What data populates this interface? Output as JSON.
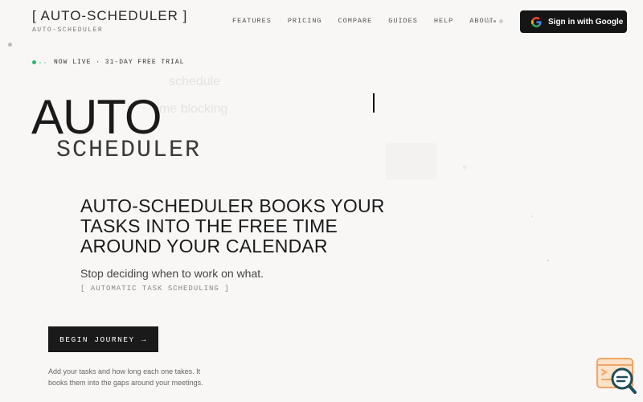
{
  "header": {
    "brand": "[ AUTO-SCHEDULER ]",
    "brand_sub": "AUTO-SCHEDULER",
    "nav": [
      "FEATURES",
      "PRICING",
      "COMPARE",
      "GUIDES",
      "HELP",
      "ABOUT"
    ],
    "signin_label": "Sign in with Google"
  },
  "hero": {
    "status": "NOW LIVE · 31-DAY FREE TRIAL",
    "ghost_words": [
      "schedule",
      "time blocking"
    ],
    "title_big": "AUTO",
    "title_small": "SCHEDULER",
    "headline": "AUTO-SCHEDULER BOOKS YOUR TASKS INTO THE FREE TIME AROUND YOUR CALENDAR",
    "subheadline": "Stop deciding when to work on what.",
    "tagline": "[ AUTOMATIC TASK SCHEDULING ]",
    "cta_label": "BEGIN JOURNEY",
    "cta_arrow": "→",
    "description": "Add your tasks and how long each one takes. It books them into the gaps around your meetings."
  },
  "colors": {
    "background": "#f8f7f5",
    "button_dark": "#151515",
    "live_green": "#2bb673",
    "widget_orange": "#f0a566",
    "widget_teal": "#1f4e5a"
  },
  "icons": {
    "google": "google-logo-icon",
    "arrow": "arrow-right-icon",
    "help": "chat-search-icon"
  }
}
